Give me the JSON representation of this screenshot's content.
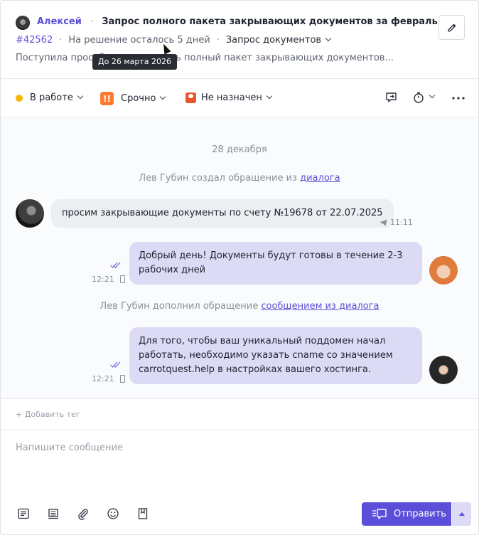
{
  "header": {
    "author": "Алексей",
    "separator": "·",
    "title": "Запрос полного пакета закрывающих документов за февраль",
    "ticket_id": "#42562",
    "deadline": "На решение осталось 5 дней",
    "request_type": "Запрос документов",
    "preview": "Поступила просьба предоставить полный пакет закрывающих документов...",
    "tooltip": "До 26 марта 2026"
  },
  "statusbar": {
    "status": "В работе",
    "priority": "Срочно",
    "priority_icon": "!!",
    "assignee": "Не назначен",
    "colors": {
      "status": "#f5b800",
      "priority": "#ff7a2f",
      "assignee": "#e8552c",
      "accent": "#5b4fd9"
    }
  },
  "chat": {
    "date": "28 декабря",
    "event1_text": "Лев Губин создал обращение из ",
    "event1_link": "диалога",
    "msg_in_text": "просим закрывающие документы по счету №19678 от 22.07.2025",
    "msg_in_time": "11:11",
    "msg_out1_text": "Добрый день! Документы будут готовы в течение 2-3 рабочих дней",
    "msg_out1_time": "12:21",
    "event2_text": "Лев Губин дополнил обращение ",
    "event2_link": "сообщением из диалога",
    "msg_out2_text": "Для того, чтобы ваш уникальный поддомен начал работать, необходимо указать cname со значением carrotquest.help в настройках вашего хостинга.",
    "msg_out2_time": "12:21"
  },
  "tags": {
    "add_label": "Добавить тег"
  },
  "composer": {
    "placeholder": "Напишите сообщение",
    "send_label": "Отправить"
  }
}
